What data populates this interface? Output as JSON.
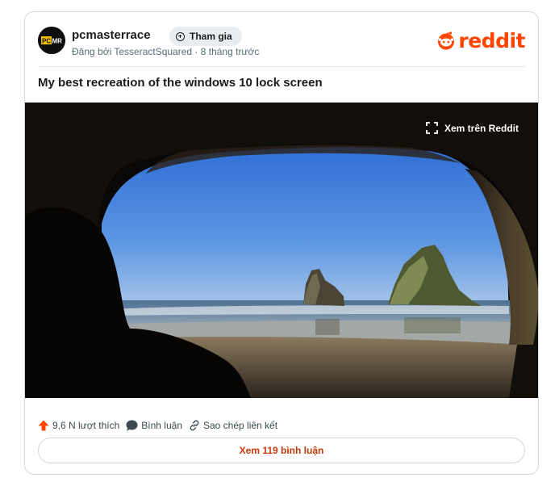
{
  "post": {
    "subreddit": "pcmasterrace",
    "avatar_text": "PCMR",
    "join_label": "Tham gia",
    "byline": "Đăng bởi TesseractSquared · 8 tháng trước",
    "brand": "reddit",
    "title": "My best recreation of the windows 10 lock screen",
    "view_on_reddit": "Xem trên Reddit"
  },
  "actions": {
    "upvotes": "9,6 N lượt thích",
    "comment": "Bình luận",
    "copy_link": "Sao chép liên kết"
  },
  "footer": {
    "view_comments": "Xem 119 bình luận"
  },
  "colors": {
    "brand_orange": "#ff4500",
    "comments_link": "#c13b0a",
    "avatar_yellow": "#f3c300"
  },
  "icons": {
    "join": "plus-circle-icon",
    "expand": "expand-icon",
    "upvote": "upvote-arrow-icon",
    "comment": "speech-bubble-icon",
    "link": "link-icon",
    "logo": "reddit-snoo-icon"
  }
}
